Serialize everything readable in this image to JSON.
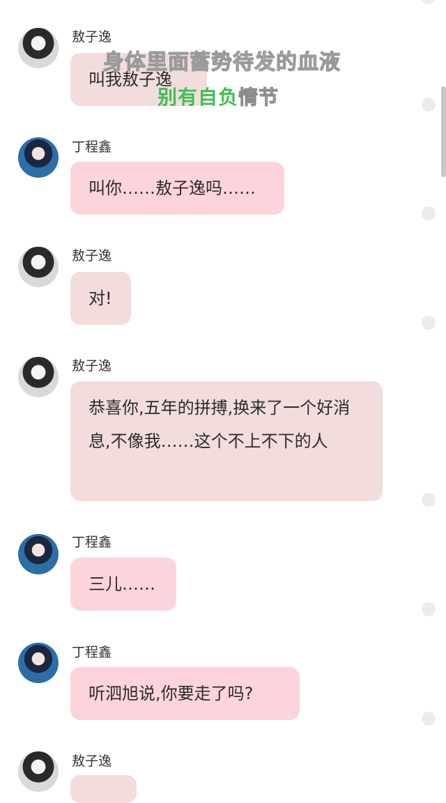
{
  "overlay": {
    "line1": "身体里面蓄势待发的血液",
    "line2_green": "别有自负",
    "line2_white": "情节"
  },
  "messages": [
    {
      "name": "敖子逸",
      "text": "叫我敖子逸"
    },
    {
      "name": "丁程鑫",
      "text": "叫你……敖子逸吗……"
    },
    {
      "name": "敖子逸",
      "text": "对!"
    },
    {
      "name": "敖子逸",
      "text": "恭喜你,五年的拼搏,换来了一个好消息,不像我……这个不上不下的人"
    },
    {
      "name": "丁程鑫",
      "text": "三儿……"
    },
    {
      "name": "丁程鑫",
      "text": "听泗旭说,你要走了吗?"
    },
    {
      "name": "敖子逸",
      "text": ""
    }
  ],
  "colors": {
    "bubble_ao": "#f2dcdc",
    "bubble_ding": "#fdd4dc"
  }
}
